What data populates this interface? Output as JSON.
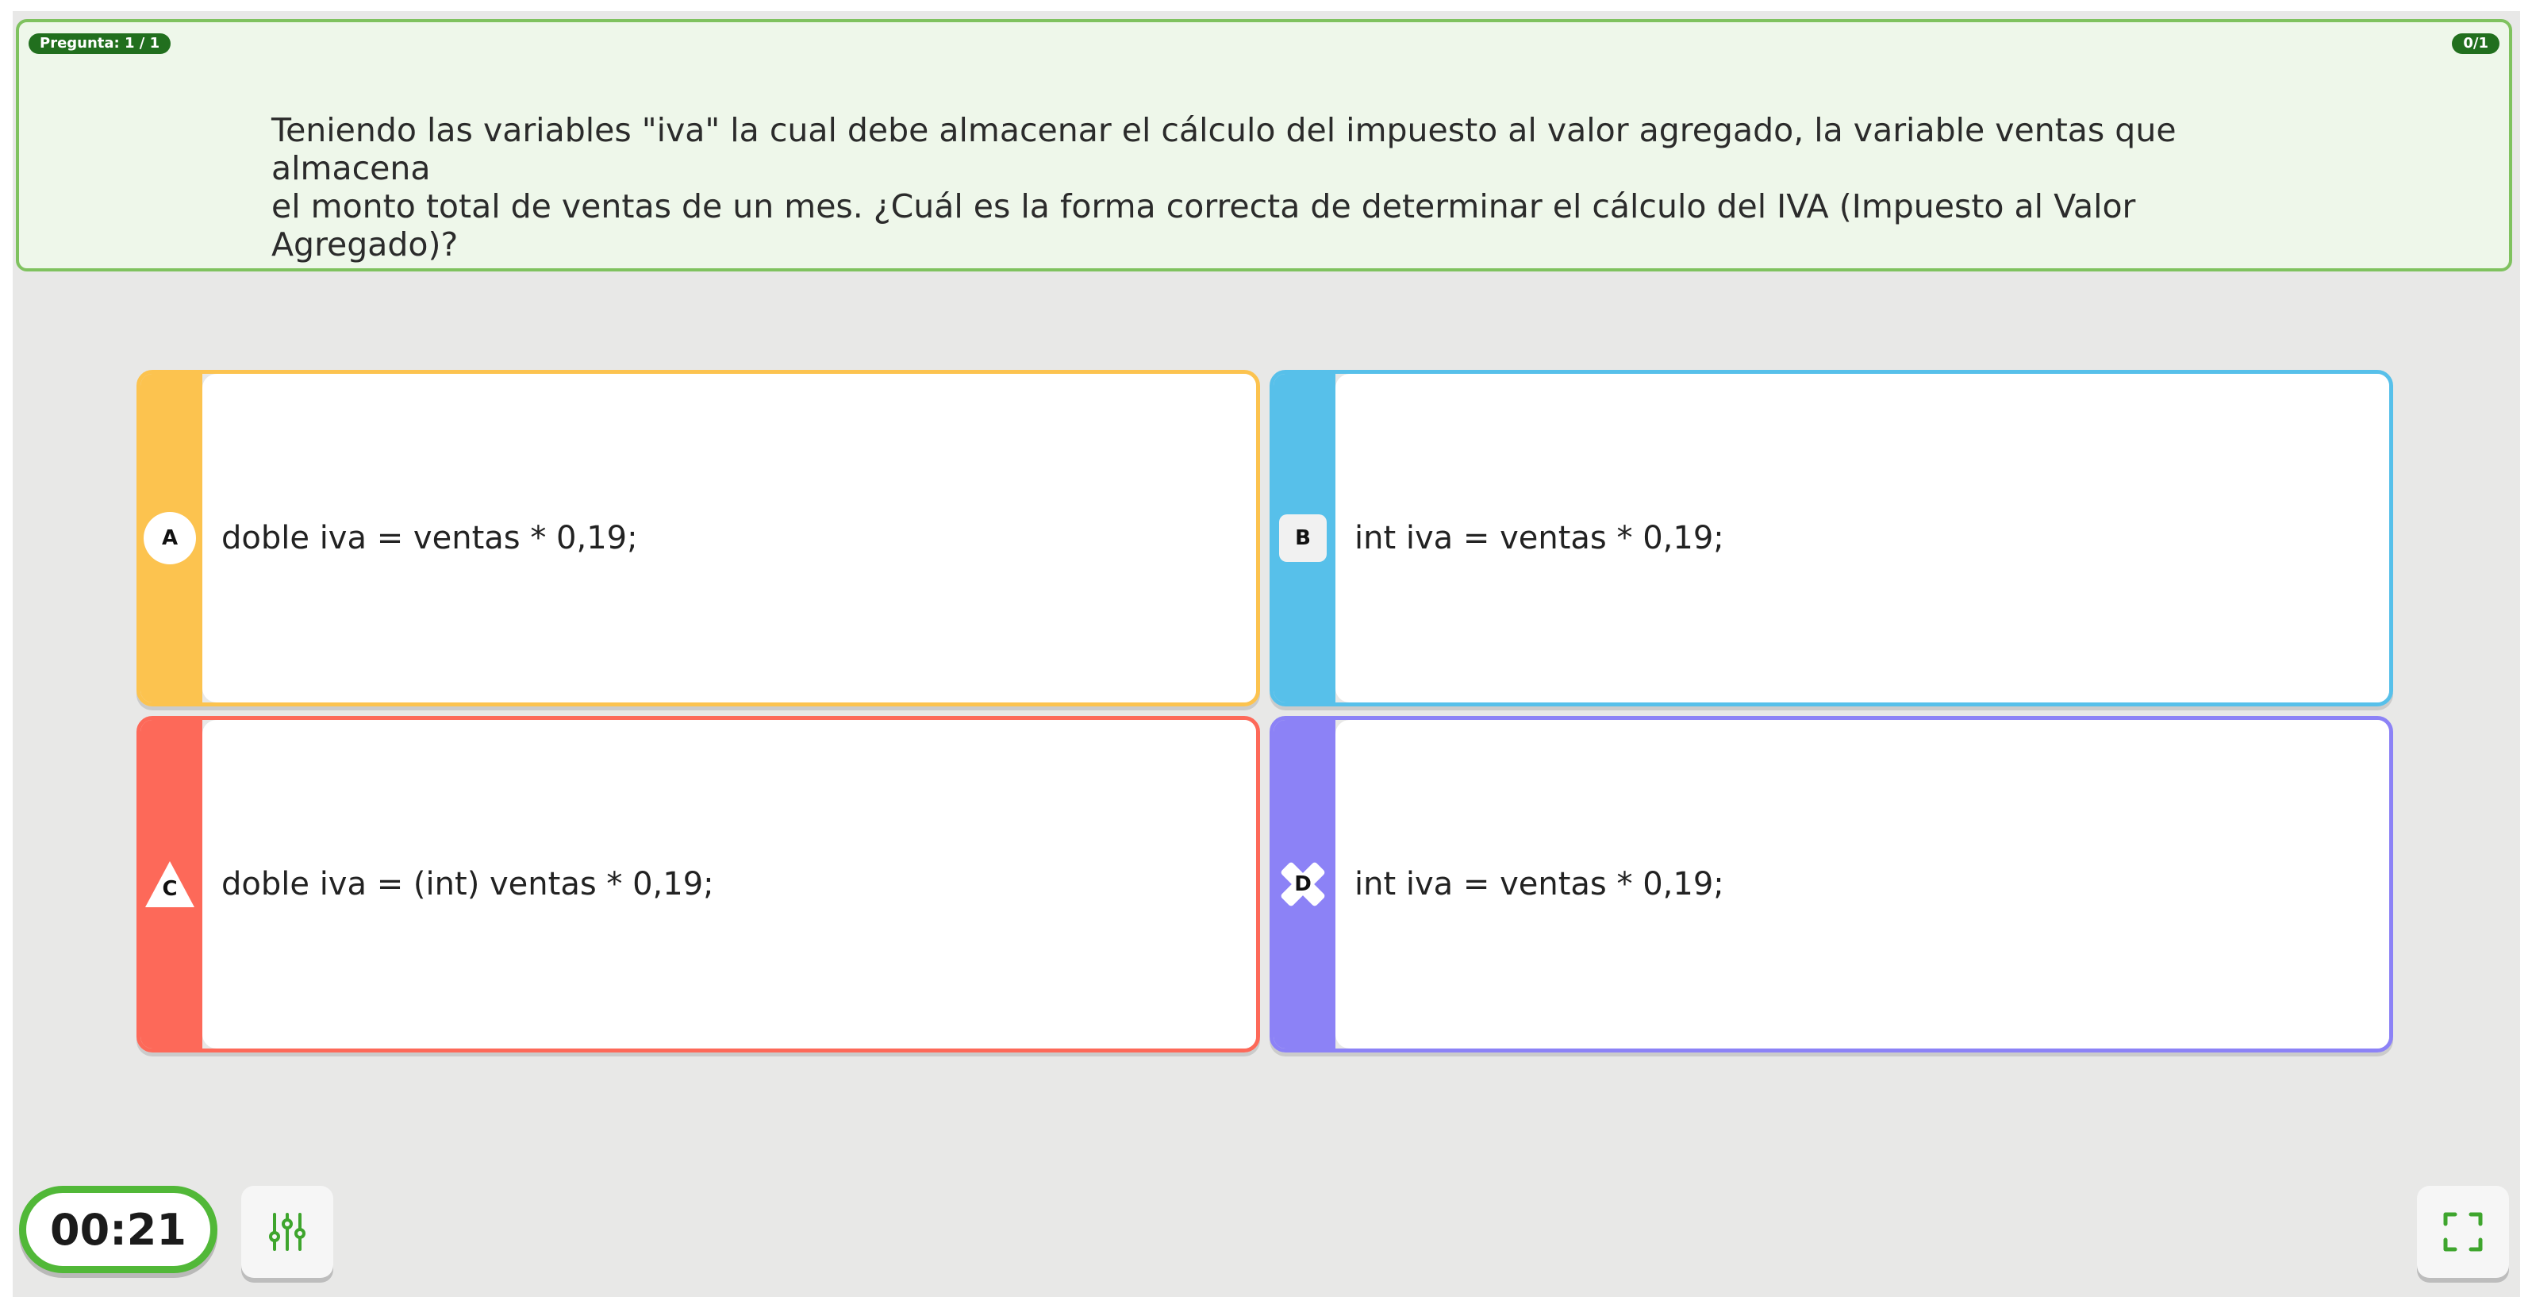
{
  "header": {
    "question_counter": "Pregunta: 1 / 1",
    "score": "0/1"
  },
  "question": {
    "line1": "Teniendo las variables \"iva\" la cual debe almacenar el cálculo del impuesto al valor agregado, la variable ventas que almacena",
    "line2": "el monto total de ventas de un mes. ¿Cuál es la forma correcta de determinar el cálculo del IVA (Impuesto al Valor Agregado)?"
  },
  "options": [
    {
      "letter": "A",
      "text": "doble iva = ventas * 0,19;",
      "color": "#fcc34f",
      "shape": "circle"
    },
    {
      "letter": "B",
      "text": "int iva = ventas * 0,19;",
      "color": "#57c0ea",
      "shape": "square"
    },
    {
      "letter": "C",
      "text": "doble iva = (int) ventas * 0,19;",
      "color": "#fd6959",
      "shape": "triangle"
    },
    {
      "letter": "D",
      "text": "int iva = ventas * 0,19;",
      "color": "#8c82f6",
      "shape": "cross"
    }
  ],
  "footer": {
    "timer": "00:21",
    "settings_icon": "sliders-icon",
    "fullscreen_icon": "fullscreen-icon",
    "accent_color": "#51b838"
  }
}
